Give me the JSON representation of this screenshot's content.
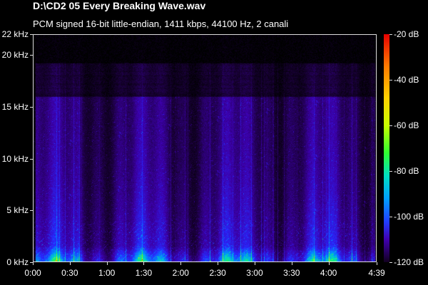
{
  "window": {
    "title": "D:\\CD2 05 Every Breaking Wave.wav",
    "subtitle": "PCM signed 16-bit little-endian, 1411 kbps, 44100 Hz, 2 canali"
  },
  "chart_data": {
    "type": "heatmap",
    "title": "D:\\CD2 05 Every Breaking Wave.wav",
    "subtitle": "PCM signed 16-bit little-endian, 1411 kbps, 44100 Hz, 2 canali",
    "y_axis": {
      "ticks": [
        "22 kHz",
        "20 kHz",
        "15 kHz",
        "10 kHz",
        "5 kHz",
        "0 kHz"
      ],
      "values": [
        22,
        20,
        15,
        10,
        5,
        0
      ],
      "range": [
        0,
        22
      ]
    },
    "x_axis": {
      "ticks": [
        "0:00",
        "0:30",
        "1:00",
        "1:30",
        "2:00",
        "2:30",
        "3:00",
        "3:30",
        "4:00",
        "4:39"
      ],
      "values_seconds": [
        0,
        30,
        60,
        90,
        120,
        150,
        180,
        210,
        240,
        279
      ],
      "range_seconds": [
        0,
        279
      ]
    },
    "colorbar": {
      "ticks": [
        "-20 dB",
        "-40 dB",
        "-60 dB",
        "-80 dB",
        "-100 dB",
        "-120 dB"
      ],
      "values": [
        -20,
        -40,
        -60,
        -80,
        -100,
        -120
      ],
      "range": [
        -120,
        -20
      ]
    },
    "grid": false,
    "legend": "right",
    "colors": [
      "#e60000",
      "#ff7a00",
      "#ffd200",
      "#30ff30",
      "#00e0c0",
      "#00a0ff",
      "#2040ff",
      "#4000b0",
      "#120020"
    ]
  }
}
